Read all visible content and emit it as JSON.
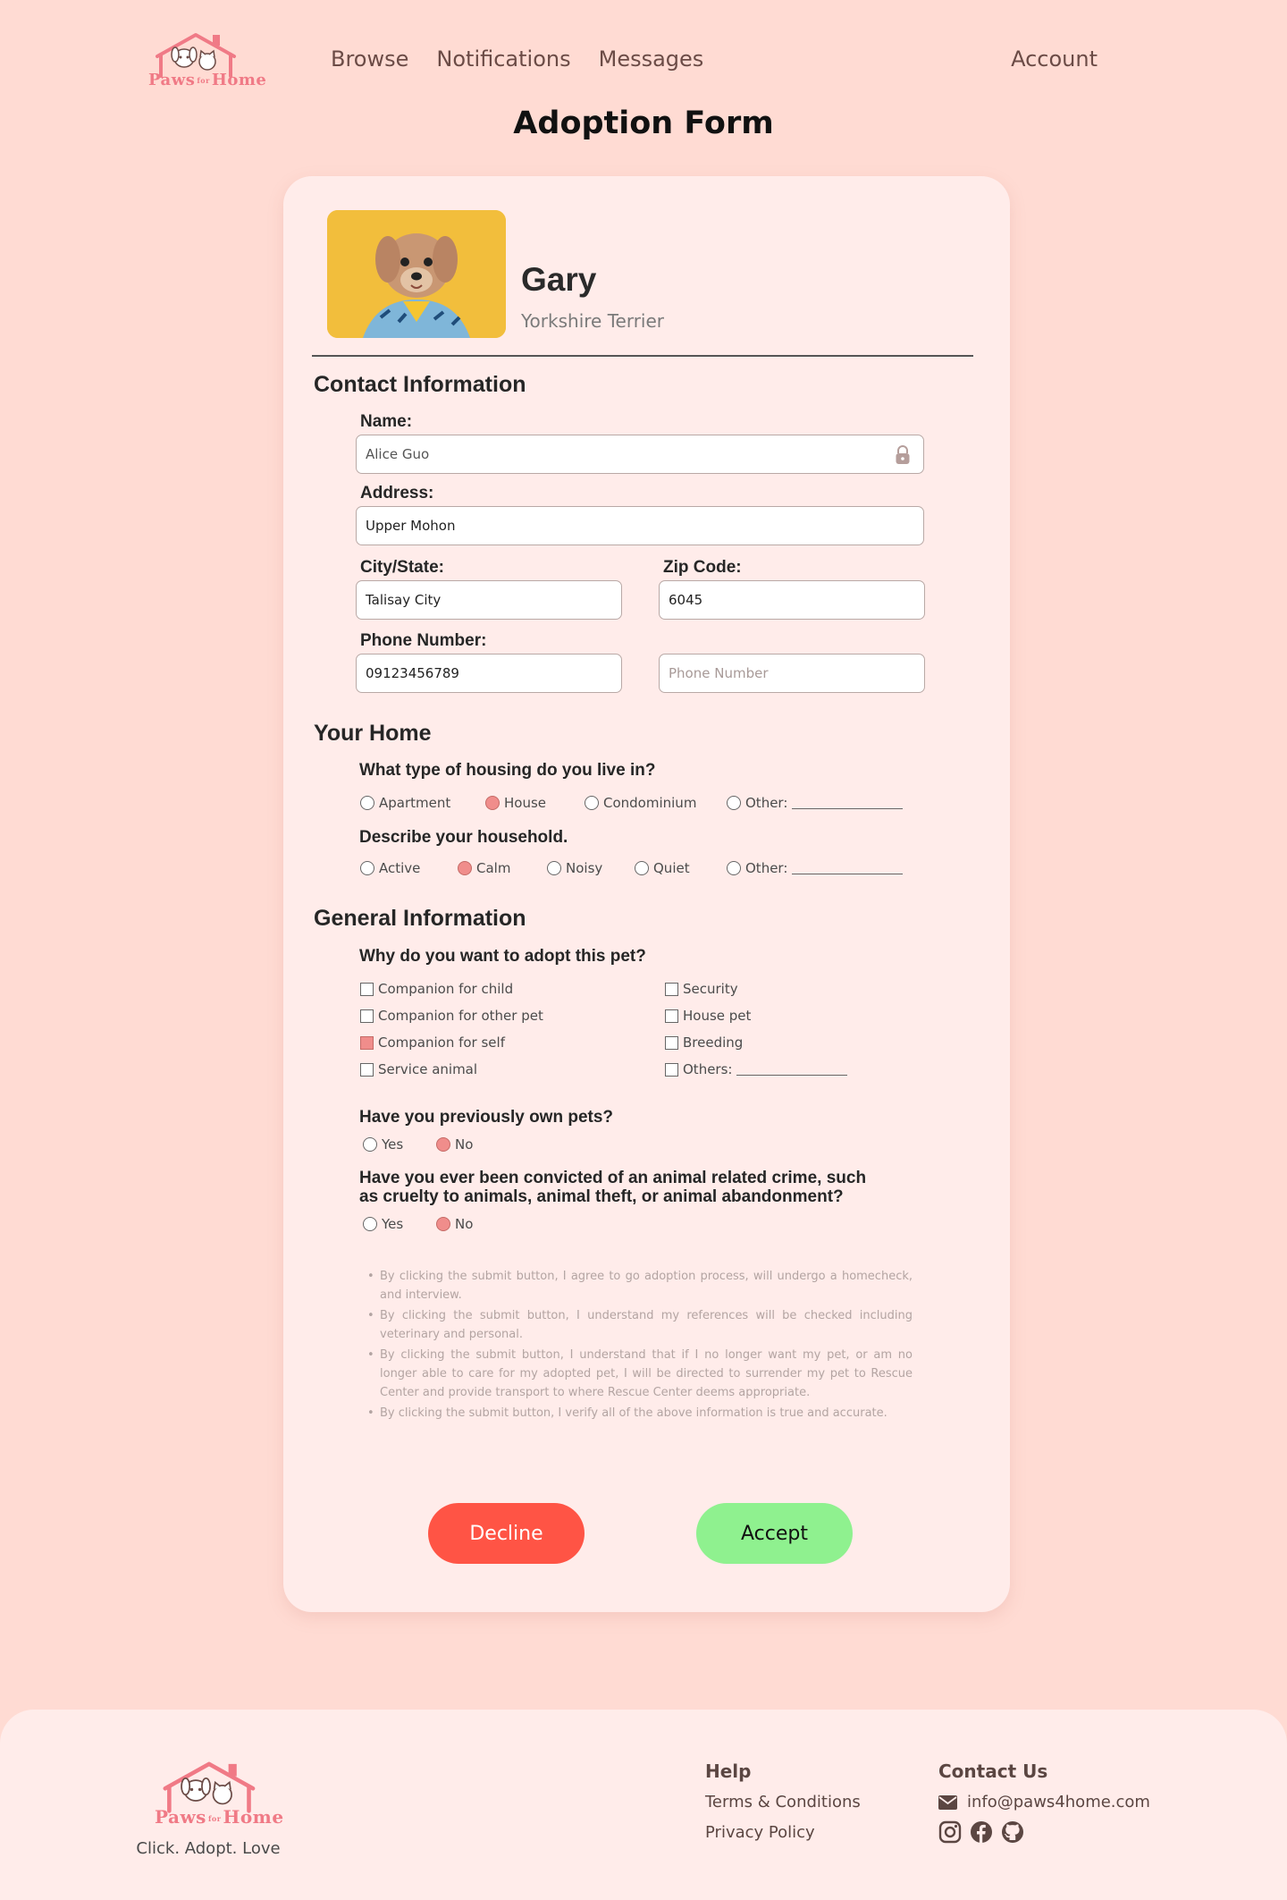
{
  "brand": {
    "name_left": "Paws",
    "name_small": "for",
    "name_right": "Home",
    "tagline": "Click. Adopt. Love"
  },
  "nav": {
    "browse": "Browse",
    "notifications": "Notifications",
    "messages": "Messages",
    "account": "Account"
  },
  "page_title": "Adoption Form",
  "pet": {
    "name": "Gary",
    "breed": "Yorkshire Terrier"
  },
  "contact": {
    "title": "Contact Information",
    "name_label": "Name:",
    "name_value": "Alice Guo",
    "address_label": "Address:",
    "address_value": "Upper Mohon",
    "city_label": "City/State:",
    "city_value": "Talisay City",
    "zip_label": "Zip Code:",
    "zip_value": "6045",
    "phone_label": "Phone Number:",
    "phone_value": "09123456789",
    "phone2_placeholder": "Phone Number"
  },
  "home": {
    "title": "Your Home",
    "housing_question": "What type of housing do you live in?",
    "housing_options": [
      "Apartment",
      "House",
      "Condominium",
      "Other:"
    ],
    "housing_selected": "House",
    "household_question": "Describe your household.",
    "household_options": [
      "Active",
      "Calm",
      "Noisy",
      "Quiet",
      "Other:"
    ],
    "household_selected": "Calm"
  },
  "general": {
    "title": "General Information",
    "why_question": "Why do you want to adopt this pet?",
    "reasons_left": [
      "Companion for child",
      "Companion for other pet",
      "Companion for self",
      "Service animal"
    ],
    "reasons_right": [
      "Security",
      "House pet",
      "Breeding",
      "Others:"
    ],
    "reasons_checked": [
      "Companion for self"
    ],
    "owned_question": "Have you previously own pets?",
    "owned_options": [
      "Yes",
      "No"
    ],
    "owned_selected": "No",
    "crime_question_line1": "Have you ever been convicted of an animal related crime, such",
    "crime_question_line2": "as cruelty to animals, animal theft, or animal abandonment?",
    "crime_options": [
      "Yes",
      "No"
    ],
    "crime_selected": "No"
  },
  "terms": [
    "By clicking the submit button, I agree to go adoption process, will undergo a homecheck, and interview.",
    "By clicking the submit button, I understand my references will be checked including veterinary and personal.",
    "By clicking the submit button, I understand that if I no longer want my pet, or am no longer able to care for my adopted pet, I will be directed to surrender my pet to Rescue Center and provide transport to where Rescue Center deems appropriate.",
    "By clicking the submit button, I verify all of the above information is true and accurate."
  ],
  "buttons": {
    "decline": "Decline",
    "accept": "Accept"
  },
  "footer": {
    "help_title": "Help",
    "terms_link": "Terms & Conditions",
    "privacy_link": "Privacy Policy",
    "contact_title": "Contact Us",
    "email": "info@paws4home.com",
    "social_icons": [
      "instagram-icon",
      "facebook-icon",
      "github-icon"
    ]
  },
  "colors": {
    "page_bg": "#ffdbd3",
    "card_bg": "#ffecea",
    "brand_pink": "#f07a86",
    "decline": "#ff5445",
    "accept": "#8ff18f",
    "selected": "#f08d8b"
  }
}
